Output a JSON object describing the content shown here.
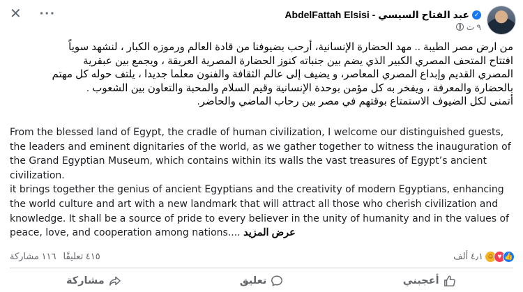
{
  "header": {
    "author_name": "AbdelFattah Elsisi - عبد الفتاح السيسي",
    "timestamp": "٩ ت"
  },
  "post": {
    "arabic_lines": [
      "من ارض مصر الطيبة .. مهد الحضارة الإنسانية، أرحب بضيوفنا من قادة العالم ورموزه الكبار ، لنشهد سوياً",
      "افتتاح المتحف المصري الكبير الذي يضم بين جنباته كنوز الحضارة المصرية العريقة ، ويجمع بين عبقرية",
      "المصري القديم وإبداع المصري المعاصر، و يضيف إلى عالم الثقافة والفنون معلما جديدا ، يلتف حوله كل مهتم",
      "بالحضارة والمعرفة ، ويفخر به كل مؤمن بوحدة الإنسانية وقيم السلام والمحبة والتعاون بين الشعوب .",
      "أتمنى لكل الضيوف الاستمتاع بوقتهم في مصر بين رحاب الماضي والحاضر."
    ],
    "english_paragraph_1": "From the blessed land of Egypt, the cradle of human civilization, I welcome our distinguished guests, the leaders and eminent dignitaries of the world, as we gather together to witness the inauguration of the Grand Egyptian Museum, which contains within its walls the vast treasures of Egypt’s ancient civilization.",
    "english_paragraph_2": "it brings together the genius of ancient Egyptians and the creativity of modern Egyptians, enhancing the world culture and art with a new landmark that will attract all those who cherish civilization and knowledge. It shall be a source of pride to every believer in the unity of humanity and in the values of peace, love, and cooperation among nations....",
    "see_more": "عرض المزيد"
  },
  "stats": {
    "reactions_count": "٤٫١ ألف",
    "comments": "٤١٥ تعليقًا",
    "shares": "١١٦ مشاركة"
  },
  "actions": {
    "like": "أعجبني",
    "comment": "تعليق",
    "share": "مشاركة"
  },
  "colors": {
    "verified": "#1877f2",
    "like": "#1877f2",
    "love": "#f33e58",
    "care": "#f7b125"
  }
}
